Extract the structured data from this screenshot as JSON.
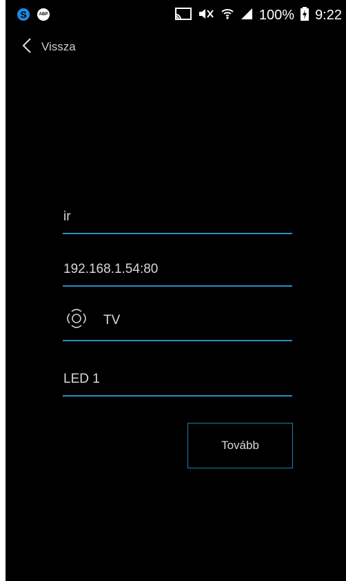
{
  "status_bar": {
    "battery": "100%",
    "time": "9:22",
    "icons": [
      "s-app-icon",
      "abp-icon",
      "cast-icon",
      "mute-icon",
      "wifi-icon",
      "signal-icon",
      "battery-icon"
    ]
  },
  "nav": {
    "back_label": "Vissza"
  },
  "form": {
    "name_value": "ir",
    "address_value": "192.168.1.54:80",
    "device_type_value": "TV",
    "device_type_icon": "remote-dpad-icon",
    "led_value": "LED 1"
  },
  "actions": {
    "next_label": "Tovább"
  },
  "colors": {
    "accent": "#2a8fc4",
    "background": "#000000",
    "text": "#d8d8d8"
  }
}
